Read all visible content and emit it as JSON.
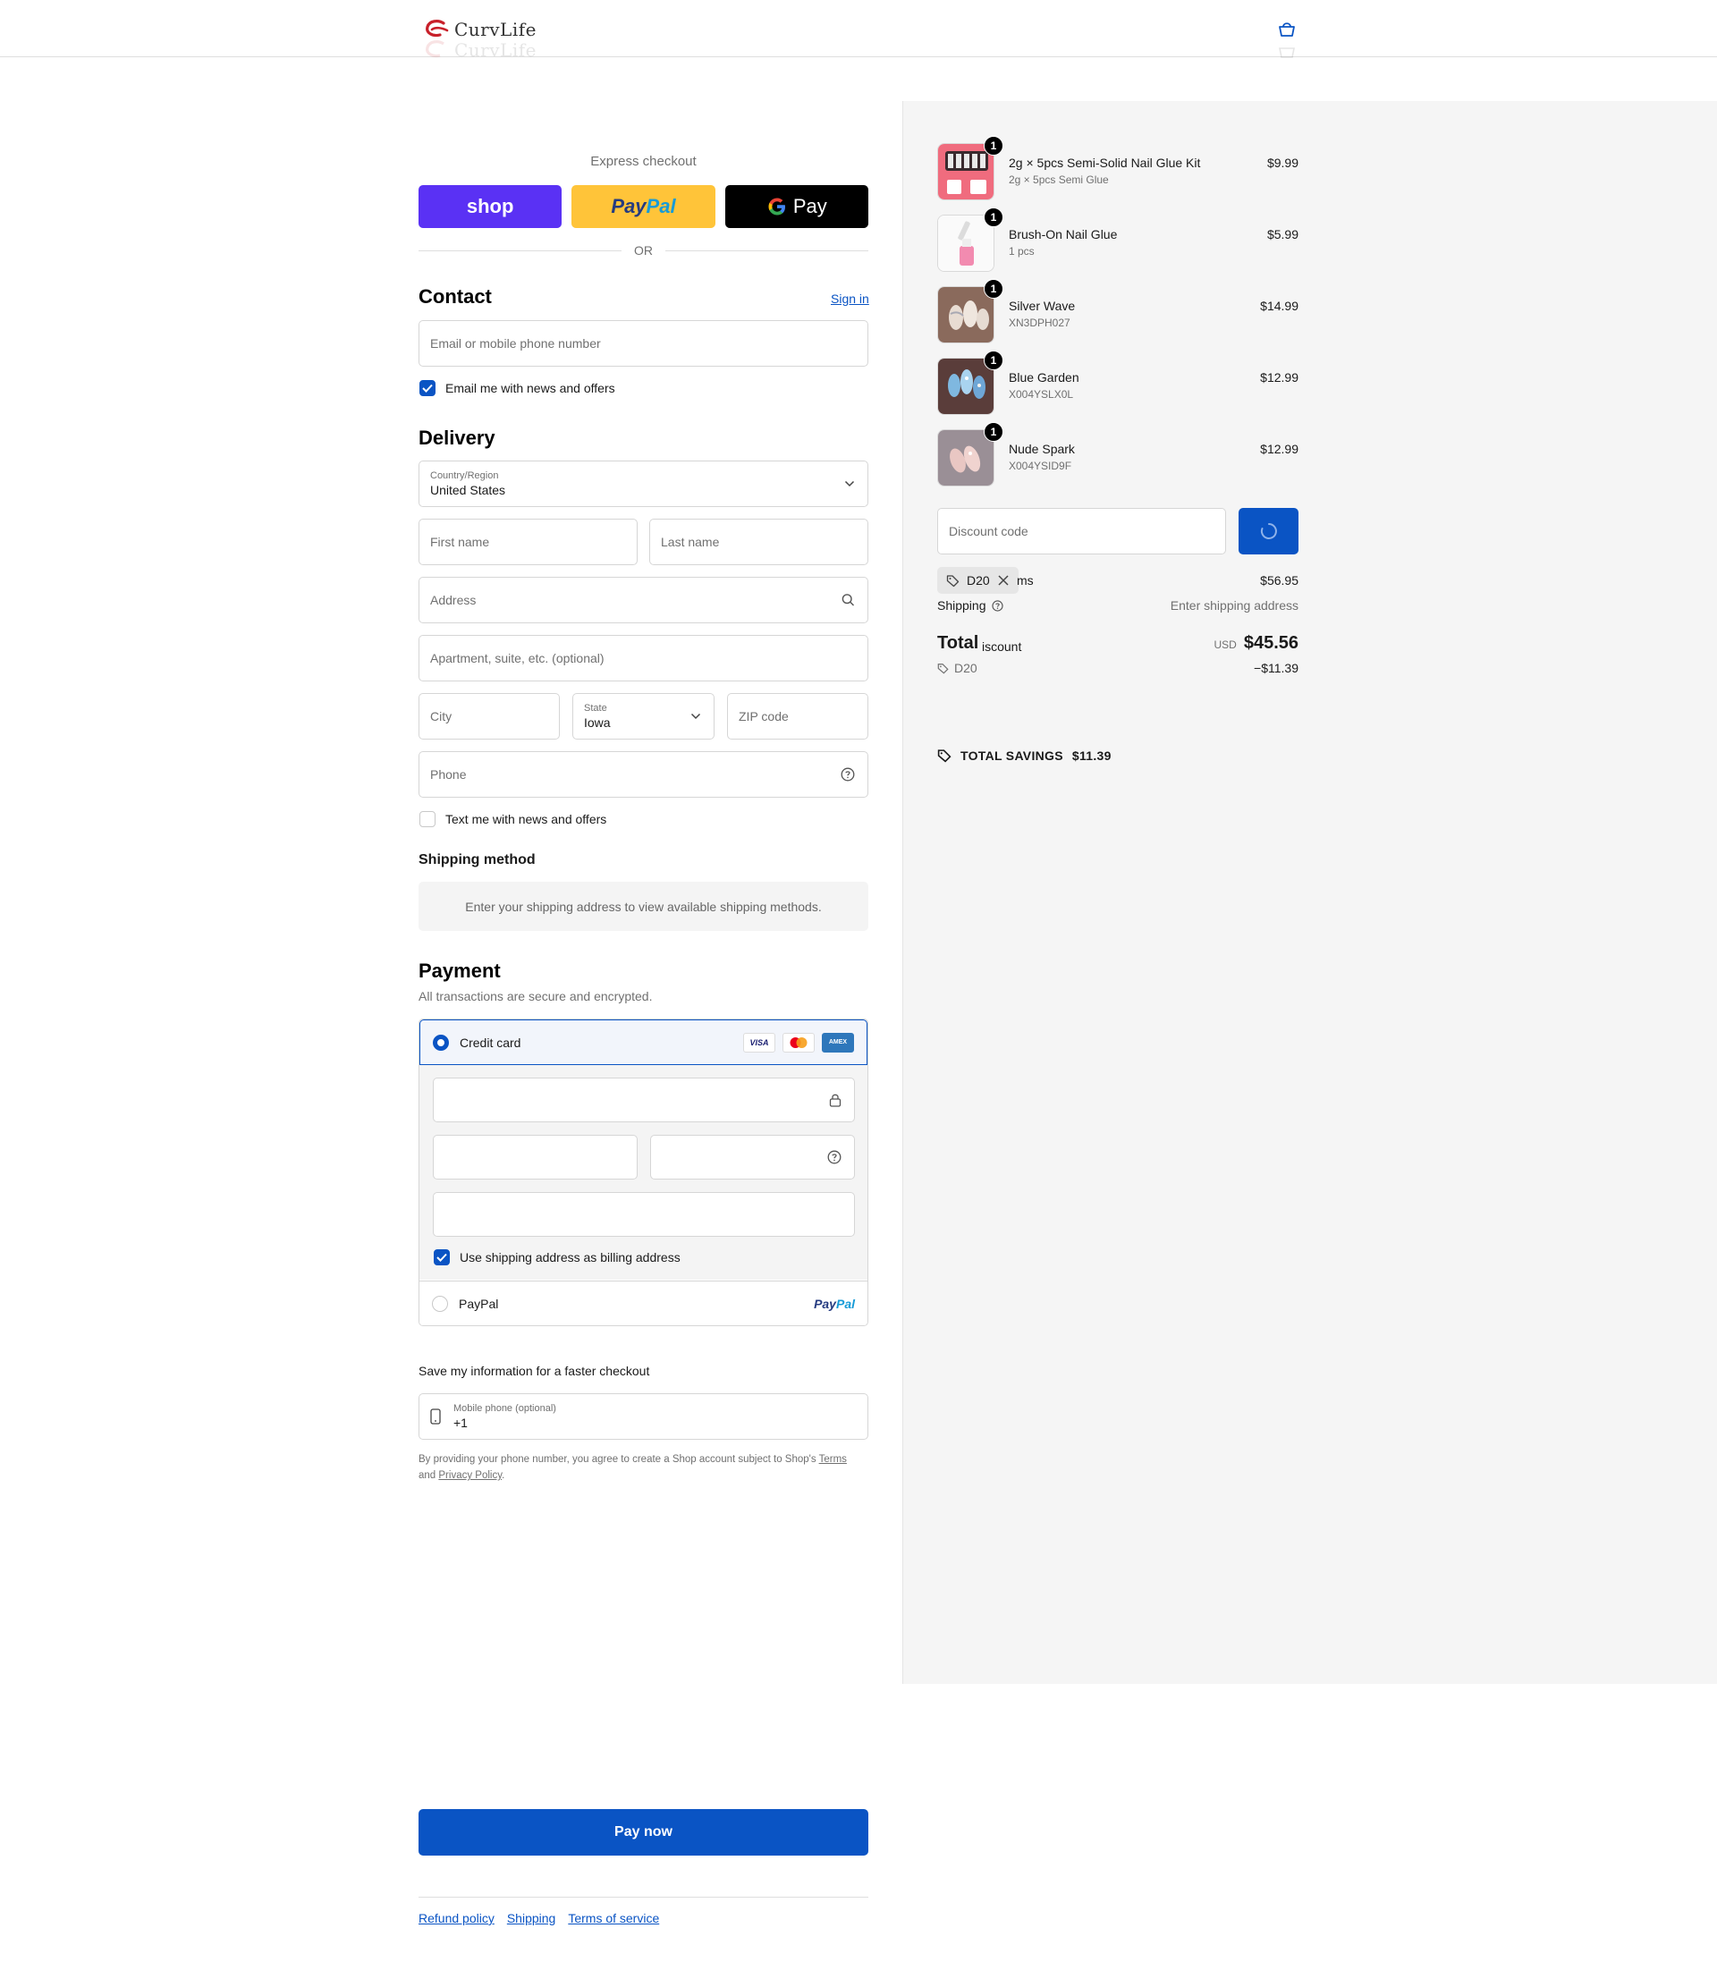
{
  "brand": {
    "name": "CurvLife"
  },
  "express": {
    "title": "Express checkout",
    "shop_label": "shop",
    "paypal_a": "Pay",
    "paypal_b": "Pal",
    "gpay_label": "Pay",
    "or_label": "OR"
  },
  "contact": {
    "heading": "Contact",
    "sign_in": "Sign in",
    "email_placeholder": "Email or mobile phone number",
    "news_label": "Email me with news and offers",
    "news_checked": true
  },
  "delivery": {
    "heading": "Delivery",
    "country_label": "Country/Region",
    "country_value": "United States",
    "first_name_placeholder": "First name",
    "last_name_placeholder": "Last name",
    "address_placeholder": "Address",
    "apartment_placeholder": "Apartment, suite, etc. (optional)",
    "city_placeholder": "City",
    "state_label": "State",
    "state_value": "Iowa",
    "zip_placeholder": "ZIP code",
    "phone_placeholder": "Phone",
    "text_label": "Text me with news and offers"
  },
  "shipping_method": {
    "heading": "Shipping method",
    "message": "Enter your shipping address to view available shipping methods."
  },
  "payment": {
    "heading": "Payment",
    "subtitle": "All transactions are secure and encrypted.",
    "credit_card_label": "Credit card",
    "cards": [
      "VISA",
      "MC",
      "AMEX"
    ],
    "billing_label": "Use shipping address as billing address",
    "paypal_label": "PayPal",
    "paypal_logo_a": "Pay",
    "paypal_logo_b": "Pal"
  },
  "save_info": {
    "title": "Save my information for a faster checkout",
    "phone_label": "Mobile phone (optional)",
    "phone_value": "+1",
    "legal_prefix": "By providing your phone number, you agree to create a Shop account subject to Shop's ",
    "terms": "Terms",
    "and": " and ",
    "privacy": "Privacy Policy",
    "period": "."
  },
  "pay_now": "Pay now",
  "footer": [
    "Refund policy",
    "Shipping",
    "Terms of service"
  ],
  "summary": {
    "items": [
      {
        "name": "2g × 5pcs Semi-Solid Nail Glue Kit",
        "sub": "2g × 5pcs Semi Glue",
        "price": "$9.99",
        "qty": "1"
      },
      {
        "name": "Brush-On Nail Glue",
        "sub": "1 pcs",
        "price": "$5.99",
        "qty": "1"
      },
      {
        "name": "Silver Wave",
        "sub": "XN3DPH027",
        "price": "$14.99",
        "qty": "1"
      },
      {
        "name": "Blue Garden",
        "sub": "X004YSLX0L",
        "price": "$12.99",
        "qty": "1"
      },
      {
        "name": "Nude Spark",
        "sub": "X004YSID9F",
        "price": "$12.99",
        "qty": "1"
      }
    ],
    "discount_placeholder": "Discount code",
    "chip_code": "D20",
    "subtotal_tail": "ms",
    "subtotal_value": "$56.95",
    "shipping_label": "Shipping",
    "shipping_value": "Enter shipping address",
    "total_label": "Total",
    "order_discount_text": "iscount",
    "currency": "USD",
    "total_value": "$45.56",
    "discount_code": "D20",
    "discount_value": "−$11.39",
    "savings_label": "TOTAL SAVINGS",
    "savings_value": "$11.39"
  },
  "colors": {
    "accent": "#0a54c4",
    "shop": "#5a31f4",
    "paypal": "#ffc439",
    "panel": "#f5f5f5"
  }
}
